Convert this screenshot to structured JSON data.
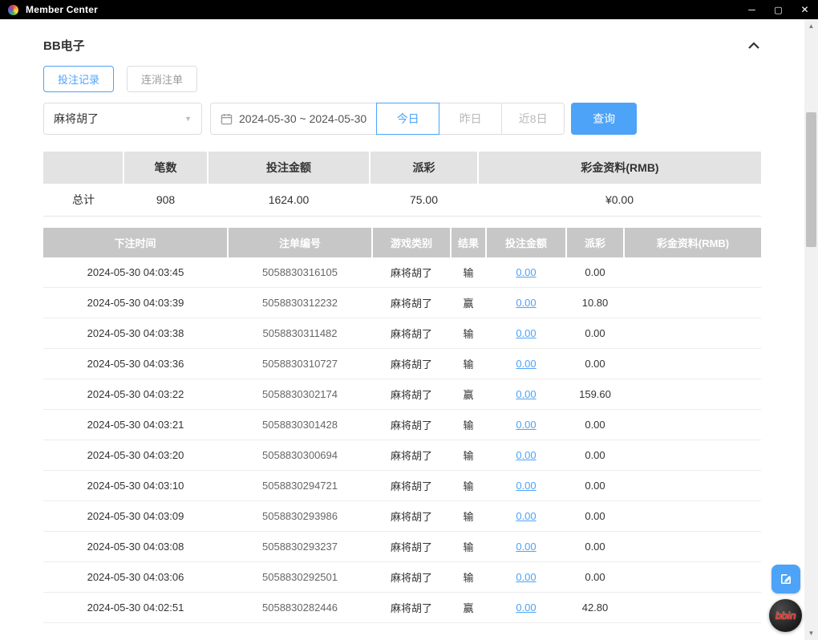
{
  "window": {
    "title": "Member Center",
    "minimize": "─",
    "maximize": "▢",
    "close": "✕"
  },
  "colors": {
    "accent_blue": "#4da3f7",
    "table_header_gray": "#c7c7c7",
    "summary_header_gray": "#e3e3e3",
    "titlebar_black": "#000000",
    "link_blue": "#4da3f7",
    "bbin_red": "#d93a31"
  },
  "page": {
    "section_title": "BB电子"
  },
  "tabs": [
    {
      "label": "投注记录",
      "active": true
    },
    {
      "label": "连消注单",
      "active": false
    }
  ],
  "filters": {
    "game_select_value": "麻将胡了",
    "select_caret": "▼",
    "date_range": "2024-05-30 ~ 2024-05-30",
    "quick_buttons": {
      "today": "今日",
      "yesterday": "昨日",
      "last8days": "近8日"
    },
    "search_label": "查询"
  },
  "summary": {
    "headers": [
      "",
      "笔数",
      "投注金额",
      "派彩",
      "彩金资料(RMB)"
    ],
    "row": [
      "总计",
      "908",
      "1624.00",
      "75.00",
      "¥0.00"
    ]
  },
  "table": {
    "headers": [
      "下注时间",
      "注单编号",
      "游戏类别",
      "结果",
      "投注金额",
      "派彩",
      "彩金资料(RMB)"
    ],
    "rows": [
      {
        "time": "2024-05-30 04:03:45",
        "order_no": "5058830316105",
        "game": "麻将胡了",
        "result": "输",
        "bet_amount": "0.00",
        "payout": "0.00",
        "bonus": ""
      },
      {
        "time": "2024-05-30 04:03:39",
        "order_no": "5058830312232",
        "game": "麻将胡了",
        "result": "赢",
        "bet_amount": "0.00",
        "payout": "10.80",
        "bonus": ""
      },
      {
        "time": "2024-05-30 04:03:38",
        "order_no": "5058830311482",
        "game": "麻将胡了",
        "result": "输",
        "bet_amount": "0.00",
        "payout": "0.00",
        "bonus": ""
      },
      {
        "time": "2024-05-30 04:03:36",
        "order_no": "5058830310727",
        "game": "麻将胡了",
        "result": "输",
        "bet_amount": "0.00",
        "payout": "0.00",
        "bonus": ""
      },
      {
        "time": "2024-05-30 04:03:22",
        "order_no": "5058830302174",
        "game": "麻将胡了",
        "result": "赢",
        "bet_amount": "0.00",
        "payout": "159.60",
        "bonus": ""
      },
      {
        "time": "2024-05-30 04:03:21",
        "order_no": "5058830301428",
        "game": "麻将胡了",
        "result": "输",
        "bet_amount": "0.00",
        "payout": "0.00",
        "bonus": ""
      },
      {
        "time": "2024-05-30 04:03:20",
        "order_no": "5058830300694",
        "game": "麻将胡了",
        "result": "输",
        "bet_amount": "0.00",
        "payout": "0.00",
        "bonus": ""
      },
      {
        "time": "2024-05-30 04:03:10",
        "order_no": "5058830294721",
        "game": "麻将胡了",
        "result": "输",
        "bet_amount": "0.00",
        "payout": "0.00",
        "bonus": ""
      },
      {
        "time": "2024-05-30 04:03:09",
        "order_no": "5058830293986",
        "game": "麻将胡了",
        "result": "输",
        "bet_amount": "0.00",
        "payout": "0.00",
        "bonus": ""
      },
      {
        "time": "2024-05-30 04:03:08",
        "order_no": "5058830293237",
        "game": "麻将胡了",
        "result": "输",
        "bet_amount": "0.00",
        "payout": "0.00",
        "bonus": ""
      },
      {
        "time": "2024-05-30 04:03:06",
        "order_no": "5058830292501",
        "game": "麻将胡了",
        "result": "输",
        "bet_amount": "0.00",
        "payout": "0.00",
        "bonus": ""
      },
      {
        "time": "2024-05-30 04:02:51",
        "order_no": "5058830282446",
        "game": "麻将胡了",
        "result": "赢",
        "bet_amount": "0.00",
        "payout": "42.80",
        "bonus": ""
      }
    ]
  },
  "scrollbar": {
    "up_arrow": "▲",
    "down_arrow": "▼"
  },
  "fab": {
    "bbin_label": "bbin"
  }
}
